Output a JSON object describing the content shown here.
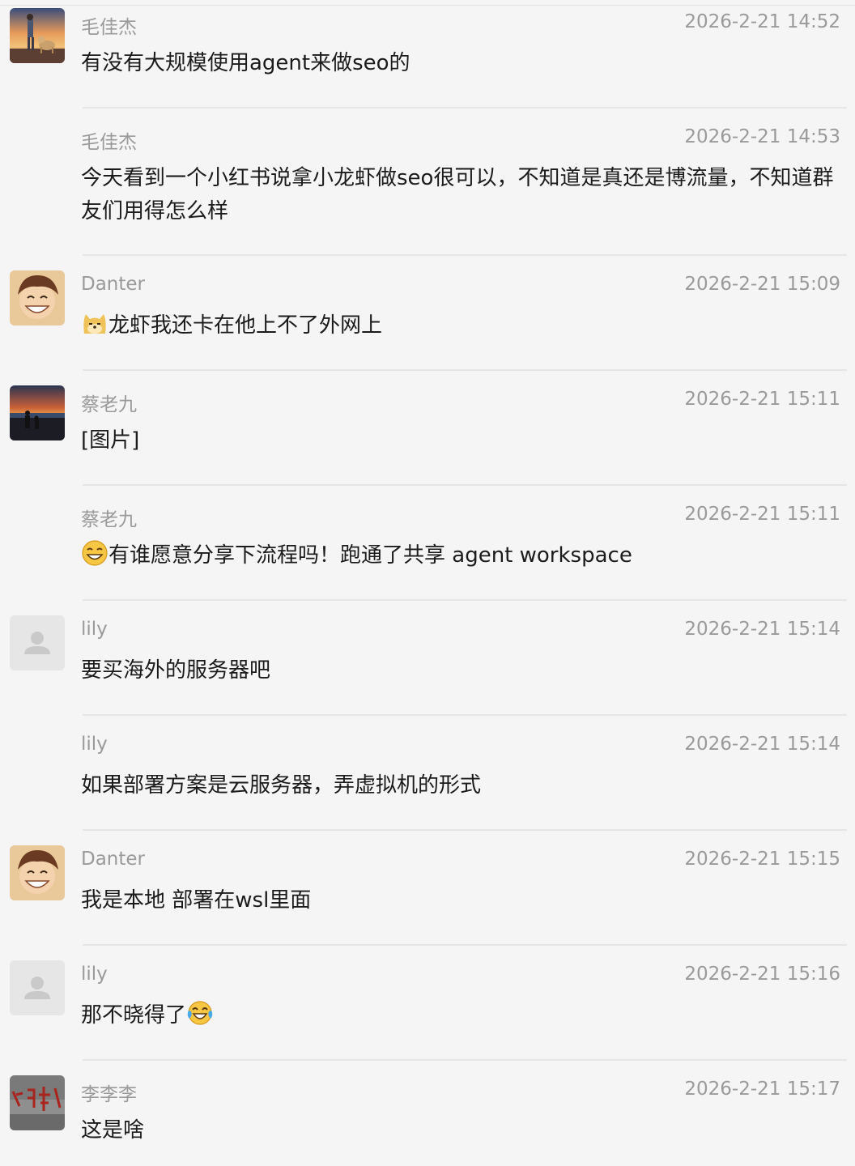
{
  "messages": [
    {
      "sender": "毛佳杰",
      "time": "2026-2-21 14:52",
      "text": "有没有大规模使用agent来做seo的",
      "avatar": "sunset-dog-avatar"
    },
    {
      "sender": "毛佳杰",
      "time": "2026-2-21 14:53",
      "text": "今天看到一个小红书说拿小龙虾做seo很可以，不知道是真还是博流量，不知道群友们用得怎么样"
    },
    {
      "sender": "Danter",
      "time": "2026-2-21 15:09",
      "text": "龙虾我还卡在他上不了外网上",
      "avatar": "smiling-boy-avatar",
      "leading_emoji": "doge-emoji"
    },
    {
      "sender": "蔡老九",
      "time": "2026-2-21 15:11",
      "text": "[图片]",
      "avatar": "sunset-silhouette-avatar"
    },
    {
      "sender": "蔡老九",
      "time": "2026-2-21 15:11",
      "text": "有谁愿意分享下流程吗！跑通了共享 agent workspace",
      "leading_emoji": "grin-emoji"
    },
    {
      "sender": "lily",
      "time": "2026-2-21 15:14",
      "text": "要买海外的服务器吧",
      "avatar": "default-user-avatar"
    },
    {
      "sender": "lily",
      "time": "2026-2-21 15:14",
      "text": "如果部署方案是云服务器，弄虚拟机的形式"
    },
    {
      "sender": "Danter",
      "time": "2026-2-21 15:15",
      "text": "我是本地 部署在wsl里面",
      "avatar": "smiling-boy-avatar"
    },
    {
      "sender": "lily",
      "time": "2026-2-21 15:16",
      "text": "那不晓得了",
      "avatar": "default-user-avatar",
      "trailing_emoji": "tears-of-joy-emoji"
    },
    {
      "sender": "李李李",
      "time": "2026-2-21 15:17",
      "text": "这是啥",
      "avatar": "calligraphy-avatar"
    }
  ],
  "colors": {
    "background": "#f5f5f5",
    "meta_text": "#9a9a9a",
    "body_text": "#1b1b1b",
    "divider": "#e6e6e6"
  }
}
